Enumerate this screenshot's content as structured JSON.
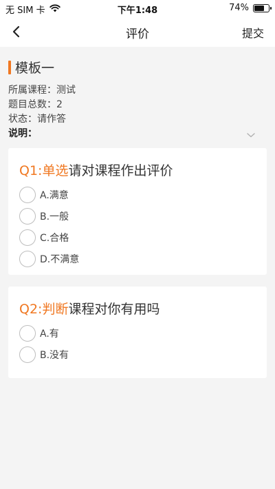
{
  "status": {
    "carrier": "无 SIM 卡",
    "time": "下午1:48",
    "battery": "74%",
    "battery_level": 0.74
  },
  "nav": {
    "title": "评价",
    "submit_label": "提交"
  },
  "template": {
    "name": "模板一",
    "course_label": "所属课程：",
    "course_value": "测试",
    "total_label": "题目总数：",
    "total_value": "2",
    "state_label": "状态：",
    "state_value": "请作答",
    "description_label": "说明："
  },
  "questions": [
    {
      "prefix": "Q1:单选",
      "text": "请对课程作出评价",
      "options": [
        "A.满意",
        "B.一般",
        "C.合格",
        "D.不满意"
      ]
    },
    {
      "prefix": "Q2:判断",
      "text": "课程对你有用吗",
      "options": [
        "A.有",
        "B.没有"
      ]
    }
  ],
  "colors": {
    "accent": "#f07822",
    "background": "#f4f4f4",
    "card": "#ffffff"
  }
}
